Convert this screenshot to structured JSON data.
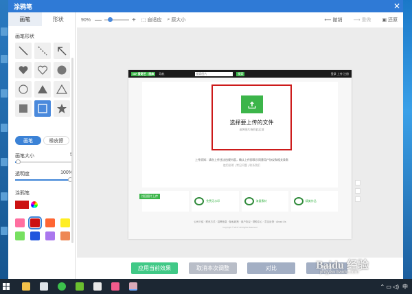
{
  "window": {
    "title": "涂鸦笔",
    "close_glyph": "✕"
  },
  "panel": {
    "tabs": [
      {
        "label": "画笔",
        "active": true
      },
      {
        "label": "形状",
        "active": false
      }
    ],
    "shape_section_label": "画笔形状",
    "shapes": [
      "line-shape",
      "dashed-line-shape",
      "arrow-shape",
      "heart-filled-shape",
      "heart-outline-shape",
      "circle-filled-shape",
      "circle-outline-shape",
      "triangle-filled-shape",
      "triangle-outline-shape",
      "square-filled-shape",
      "square-outline-shape",
      "star-filled-shape"
    ],
    "selected_shape": "square-outline-shape",
    "modes": [
      {
        "label": "画笔",
        "active": true
      },
      {
        "label": "橡皮擦",
        "active": false
      }
    ],
    "brush_size": {
      "label": "画笔大小",
      "value": "5"
    },
    "opacity": {
      "label": "透明度",
      "value": "100%"
    },
    "color_section_label": "涂鸦笔",
    "current_color": "#cc1111",
    "swatches": [
      "#ff6fa0",
      "#cc1111",
      "#ff6633",
      "#ffee22",
      "#77e060",
      "#2255dd",
      "#aa77ee",
      "#ee8855"
    ]
  },
  "toolbar": {
    "zoom": "90%",
    "minus": "—",
    "plus": "+",
    "fit": "自适应",
    "original": "原大小",
    "undo": "撤销",
    "redo": "重做",
    "restore": "还原"
  },
  "webpage": {
    "logo": "GIF 爱奇艺 · 图库",
    "nav_item": "导航",
    "search_placeholder": "搜索图片",
    "search_btn": "搜索",
    "nav_right": [
      "登录",
      "上传",
      "注册"
    ],
    "upload_title": "选择要上传的文件",
    "upload_sub": "或将图片拖到此区域",
    "note": "上传须知：请勿上传违法违规内容，确认上传即表示同意用户协议和相关条款",
    "links": "使用说明 | 常见问题 | 联系我们",
    "features": [
      {
        "tag": "找回图片上传",
        "text": ""
      },
      {
        "tag": "",
        "text": "免费无水印"
      },
      {
        "tag": "",
        "text": "海量素材"
      },
      {
        "tag": "",
        "text": "精美作品"
      }
    ],
    "footer_links": "公司介绍 · 联系方式 · 招聘信息 · 隐私政策 · 用户协议 · 帮助中心 · 意见反馈 · About Us",
    "copyright": "Copyright © 2017 All Rights Reserved"
  },
  "buttons": {
    "apply": "应用当前效果",
    "cancel": "取消本次调整",
    "compare": "对比",
    "save": "保存"
  },
  "watermark": {
    "main": "Baidu 经验",
    "sub": "jingyan.baidu.com"
  },
  "taskbar": {
    "ime": "中",
    "tray_glyphs": "⌃ ▭ ◁)"
  },
  "colors": {
    "accent": "#3b82d6",
    "titlebar": "#2f7ad6",
    "apply": "#41c987",
    "highlight_box": "#cc1a1a"
  }
}
